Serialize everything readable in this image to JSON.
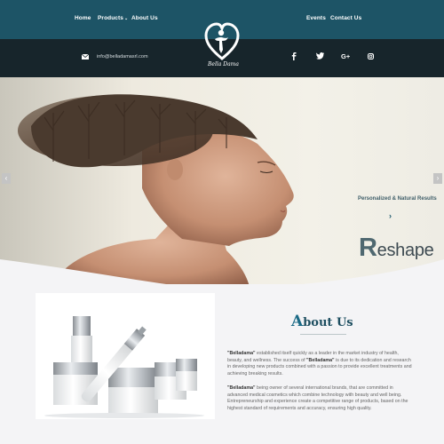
{
  "nav": {
    "home": "Home",
    "products": "Products",
    "about": "About Us",
    "events": "Events",
    "contact": "Contact Us"
  },
  "info": {
    "email": "info@belladamasrl.com"
  },
  "social": {
    "facebook": "f",
    "twitter": "t",
    "googleplus": "G+",
    "instagram": "ig"
  },
  "logo": {
    "text": "Bella Dama",
    "icon": "heart-figure-logo"
  },
  "hero": {
    "title_first": "R",
    "title_rest": "eshape",
    "tagline": "Personalized & Natural Results",
    "prev": "‹",
    "next": "›",
    "next_glyph": "›"
  },
  "about": {
    "heading_first": "A",
    "heading_rest": "bout Us",
    "p1_brand": "\"Belladama\"",
    "p1_text1": " established itself quickly as a leader in the market industry of health, beauty, and wellness. The success of ",
    "p1_brand2": "\"Belladama\"",
    "p1_text2": " is due to its dedication and research in developing new products combined with a passion to provide excellent treatments and achieving breaking results.",
    "p2_brand": "\"Belladama\"",
    "p2_text": " being owner of several international brands, that are committed in advanced medical cosmetics which combine technology with beauty and well being. Entrepreneurship and experience create a competitive range of products, based on the highest standard of requirements and accuracy, ensuring high quality."
  },
  "colors": {
    "nav_bg": "#1d5466",
    "info_bg": "#17252b",
    "accent": "#1b6a86"
  }
}
